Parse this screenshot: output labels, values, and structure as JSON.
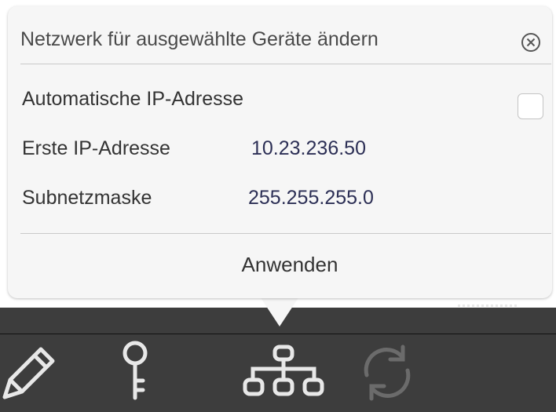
{
  "dialog": {
    "title": "Netzwerk für ausgewählte Geräte ändern",
    "close_icon": "close-circle-icon",
    "auto_ip_label": "Automatische IP-Adresse",
    "auto_ip_checked": false,
    "first_ip_label": "Erste IP-Adresse",
    "first_ip_value": "10.23.236.50",
    "subnet_label": "Subnetzmaske",
    "subnet_value": "255.255.255.0",
    "apply_label": "Anwenden"
  },
  "toolbar": {
    "icons": [
      "pencil-icon",
      "key-icon",
      "network-icon",
      "refresh-icon"
    ]
  },
  "colors": {
    "popover_bg": "#f6f6f6",
    "toolbar_bg": "#3d3d3d",
    "value_text": "#2c2f55"
  }
}
